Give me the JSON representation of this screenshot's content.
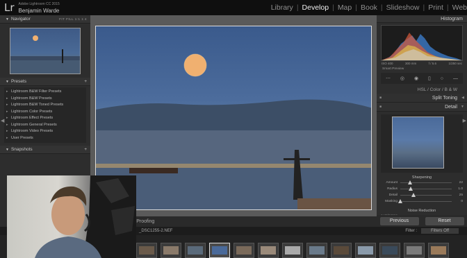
{
  "app": {
    "logo": "Lr",
    "product": "Adobe Lightroom CC 2015",
    "user": "Benjamin Warde"
  },
  "modules": [
    "Library",
    "Develop",
    "Map",
    "Book",
    "Slideshow",
    "Print",
    "Web"
  ],
  "active_module": "Develop",
  "left_panel": {
    "navigator": {
      "title": "Navigator",
      "zoom_options": [
        "FIT",
        "FILL",
        "1:1",
        "1:4"
      ]
    },
    "presets": {
      "title": "Presets",
      "items": [
        "Lightroom B&W Filter Presets",
        "Lightroom B&W Presets",
        "Lightroom B&W Toned Presets",
        "Lightroom Color Presets",
        "Lightroom Effect Presets",
        "Lightroom General Presets",
        "Lightroom Video Presets",
        "User Presets"
      ]
    },
    "snapshots": {
      "title": "Snapshots"
    }
  },
  "center": {
    "soft_proofing": "rt Proofing"
  },
  "right_panel": {
    "histogram": {
      "title": "Histogram",
      "info": [
        "ISO 400",
        "300 mm",
        "f / 5.6",
        "1/250 sec"
      ],
      "smart_preview": "Smart Preview"
    },
    "sections": {
      "hsl": "HSL  /  Color  /  B & W",
      "split_toning": "Split Toning",
      "detail": "Detail"
    },
    "sharpening": {
      "title": "Sharpening",
      "sliders": [
        {
          "label": "Amount",
          "value": "22",
          "pos": 0.19
        },
        {
          "label": "Radius",
          "value": "1.0",
          "pos": 0.2
        },
        {
          "label": "Detail",
          "value": "25",
          "pos": 0.25
        },
        {
          "label": "Masking",
          "value": "0",
          "pos": 0.0
        }
      ]
    },
    "noise_reduction": {
      "title": "Noise Reduction",
      "luminance": "Luminance"
    },
    "buttons": {
      "previous": "Previous",
      "reset": "Reset"
    }
  },
  "filmstrip": {
    "filename": "_DSC1255-2.NEF",
    "filter_label": "Filter :",
    "filter_value": "Filters Off"
  },
  "colors": {
    "topbar": "#0f0f0f",
    "panel": "#2d2d2d",
    "active_module": "#f0f0f0",
    "moon": "#f0b070"
  }
}
